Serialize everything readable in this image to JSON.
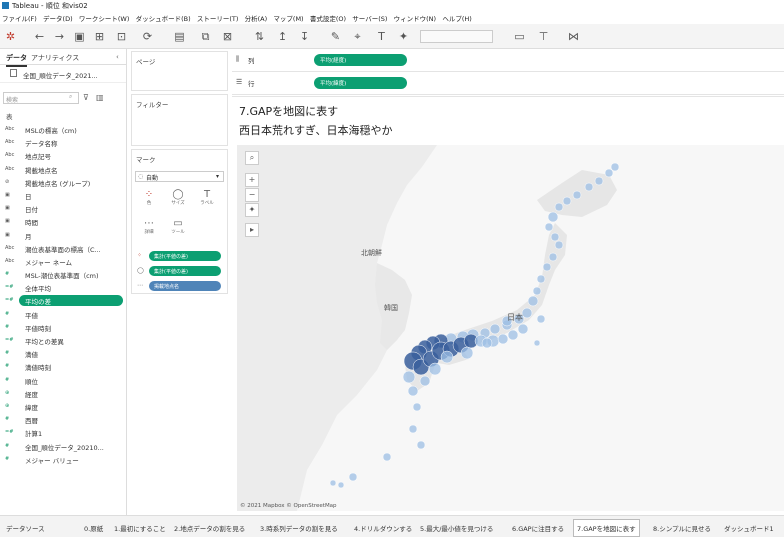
{
  "window": {
    "title": "Tableau - 順位 和vis02"
  },
  "menu": [
    "ファイル(F)",
    "データ(D)",
    "ワークシート(W)",
    "ダッシュボード(B)",
    "ストーリー(T)",
    "分析(A)",
    "マップ(M)",
    "書式設定(O)",
    "サーバー(S)",
    "ウィンドウ(N)",
    "ヘルプ(H)"
  ],
  "left_panel": {
    "tab_data": "データ",
    "tab_analytics": "アナリティクス",
    "collapse": "‹",
    "datasource": "全国_順位データ_2021...",
    "search_placeholder": "検索",
    "section_dimensions": "表",
    "fields": [
      {
        "type": "Abc",
        "name": "MSLの標高（cm)",
        "measure": false
      },
      {
        "type": "Abc",
        "name": "データ名称",
        "measure": false
      },
      {
        "type": "Abc",
        "name": "地点記号",
        "measure": false
      },
      {
        "type": "Abc",
        "name": "掲載地点名",
        "measure": false
      },
      {
        "type": "⊘",
        "name": "掲載地点名 (グループ)",
        "measure": false
      },
      {
        "type": "▣",
        "name": "日",
        "measure": false
      },
      {
        "type": "▣",
        "name": "日付",
        "measure": false
      },
      {
        "type": "▣",
        "name": "時間",
        "measure": false
      },
      {
        "type": "▣",
        "name": "月",
        "measure": false
      },
      {
        "type": "Abc",
        "name": "潮位表基準面の標高（C...",
        "measure": false
      },
      {
        "type": "Abc",
        "name": "メジャー ネーム",
        "measure": false
      },
      {
        "type": "#",
        "name": "MSL-潮位表基準面（cm)",
        "measure": true
      },
      {
        "type": "=#",
        "name": "全体平均",
        "measure": true
      },
      {
        "type": "=#",
        "name": "平均の差",
        "measure": true,
        "selected": true
      },
      {
        "type": "#",
        "name": "平値",
        "measure": true
      },
      {
        "type": "#",
        "name": "平値時刻",
        "measure": true
      },
      {
        "type": "=#",
        "name": "平均との差異",
        "measure": true
      },
      {
        "type": "#",
        "name": "満値",
        "measure": true
      },
      {
        "type": "#",
        "name": "満値時刻",
        "measure": true
      },
      {
        "type": "#",
        "name": "順位",
        "measure": true
      },
      {
        "type": "⊕",
        "name": "経度",
        "measure": true
      },
      {
        "type": "⊕",
        "name": "緯度",
        "measure": true
      },
      {
        "type": "#",
        "name": "西暦",
        "measure": true
      },
      {
        "type": "=#",
        "name": "計算1",
        "measure": true
      },
      {
        "type": "#",
        "name": "全国_順位データ_20210...",
        "measure": true
      },
      {
        "type": "#",
        "name": "メジャー バリュー",
        "measure": true
      }
    ]
  },
  "cards": {
    "pages": "ページ",
    "filters": "フィルター",
    "marks": "マーク",
    "mark_type": "自動",
    "mark_btns": [
      {
        "icon": "⁘",
        "label": "色"
      },
      {
        "icon": "◯",
        "label": "サイズ"
      },
      {
        "icon": "T",
        "label": "ラベル"
      },
      {
        "icon": "⋯",
        "label": "詳細"
      },
      {
        "icon": "▭",
        "label": "ツール"
      }
    ],
    "mark_pills": [
      "集計(平値の差)",
      "集計(平値の差)",
      "掲載地点名"
    ]
  },
  "shelves": {
    "columns_label": "列",
    "rows_label": "行",
    "columns_pill": "平均(経度)",
    "rows_pill": "平均(緯度)"
  },
  "view": {
    "title_line1": "7.GAPを地図に表す",
    "title_line2": "西日本荒れすぎ、日本海穏やか",
    "map_labels": {
      "north_korea": "北朝鮮",
      "south_korea": "韓国",
      "japan": "日本"
    },
    "credit": "© 2021 Mapbox © OpenStreetMap"
  },
  "status_tabs": [
    {
      "label": "データソース",
      "active": false
    },
    {
      "label": "0.原紙",
      "active": false
    },
    {
      "label": "1.最初にすること",
      "active": false
    },
    {
      "label": "2.地点データの割を見る",
      "active": false
    },
    {
      "label": "3.時系列データの割を見る",
      "active": false
    },
    {
      "label": "4.ドリルダウンする",
      "active": false
    },
    {
      "label": "5.最大/最小値を見つける",
      "active": false
    },
    {
      "label": "6.GAPに注目する",
      "active": false
    },
    {
      "label": "7.GAPを地図に表す",
      "active": true
    },
    {
      "label": "8.シンプルに見せる",
      "active": false
    },
    {
      "label": "ダッシュボード1",
      "active": false
    }
  ],
  "colors": {
    "accent_green": "#0c9f72",
    "pill_blue": "#4f84b8",
    "mark_light": "#9dbfe4",
    "mark_dark": "#3a5f9c"
  }
}
